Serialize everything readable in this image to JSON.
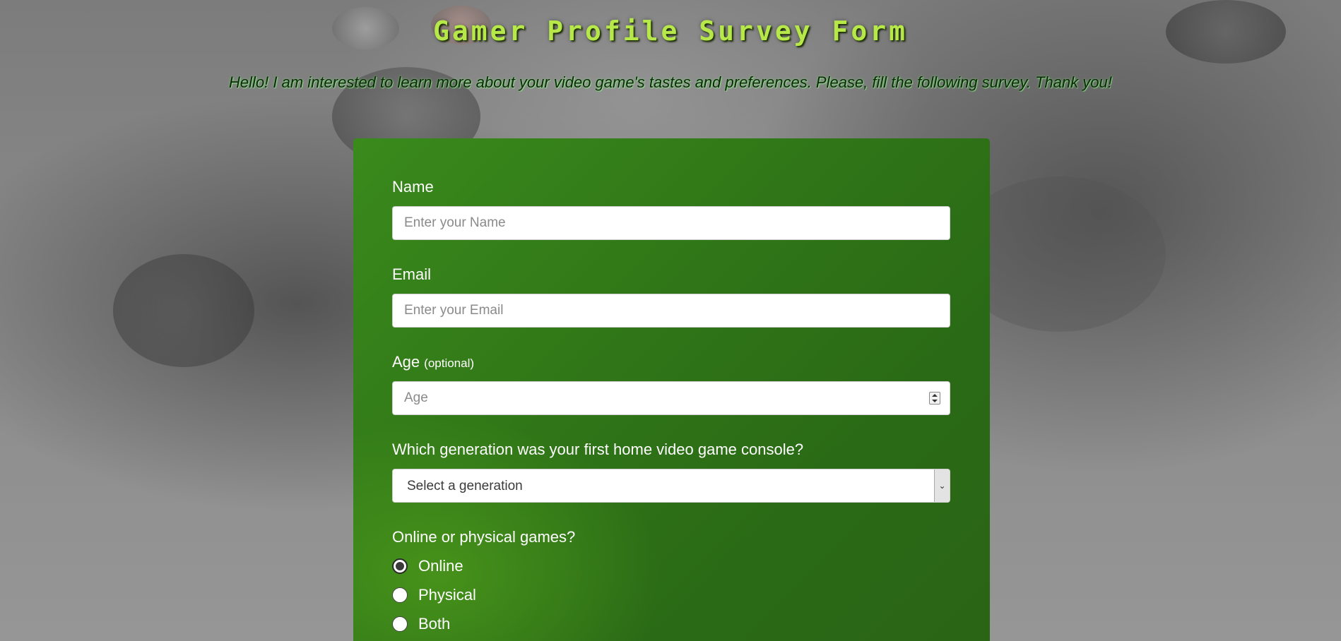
{
  "header": {
    "title": "Gamer Profile Survey Form",
    "description": "Hello! I am interested to learn more about your video game's tastes and preferences. Please, fill the following survey. Thank you!"
  },
  "form": {
    "name": {
      "label": "Name",
      "placeholder": "Enter your Name"
    },
    "email": {
      "label": "Email",
      "placeholder": "Enter your Email"
    },
    "age": {
      "label": "Age",
      "optional_note": "(optional)",
      "placeholder": "Age"
    },
    "generation": {
      "label": "Which generation was your first home video game console?",
      "selected": "Select a generation"
    },
    "game_type": {
      "label": "Online or physical games?",
      "options": [
        {
          "label": "Online",
          "checked": true
        },
        {
          "label": "Physical",
          "checked": false
        },
        {
          "label": "Both",
          "checked": false
        }
      ]
    }
  },
  "colors": {
    "title": "#b6e84a",
    "form_background": "#2f7417",
    "page_background": "#8f8f8f"
  }
}
